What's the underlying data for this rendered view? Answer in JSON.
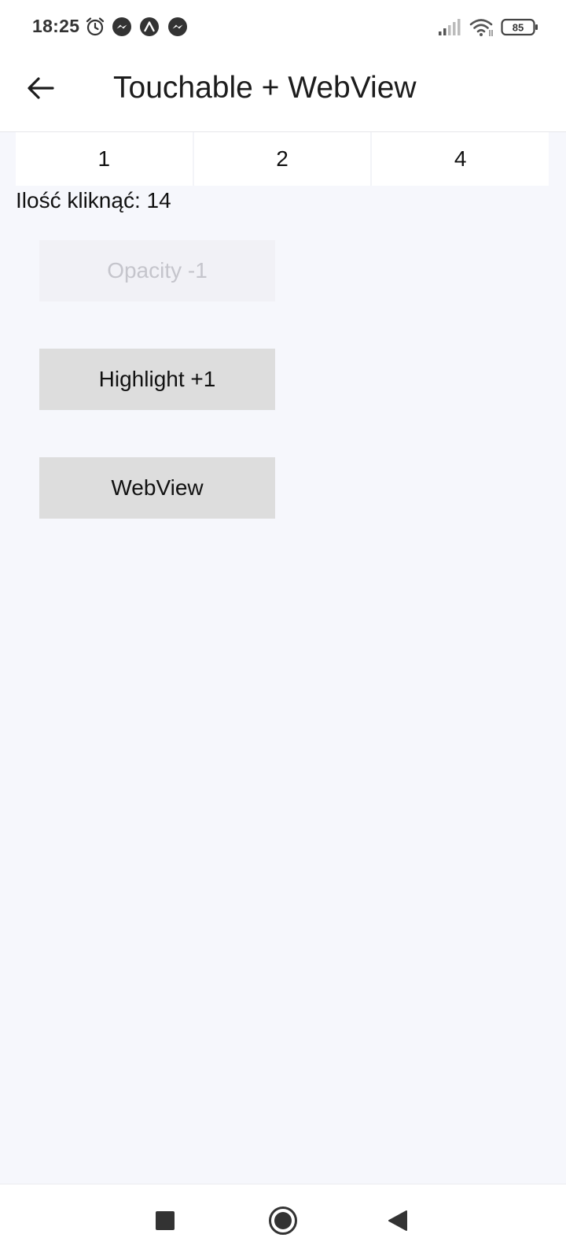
{
  "status_bar": {
    "time": "18:25",
    "battery": "85",
    "icons": [
      "alarm-icon",
      "messenger-icon",
      "expo-icon",
      "messenger-icon",
      "signal-icon",
      "wifi-icon",
      "battery-icon"
    ]
  },
  "app_bar": {
    "title": "Touchable + WebView",
    "back_icon": "arrow-left-icon"
  },
  "counters": {
    "values": [
      "1",
      "2",
      "4"
    ]
  },
  "click_count": {
    "text": "Ilość kliknąć: 14"
  },
  "buttons": {
    "opacity_label": "Opacity -1",
    "highlight_label": "Highlight +1",
    "webview_label": "WebView"
  },
  "nav_bar": {
    "icons": [
      "recents-square-icon",
      "home-circle-icon",
      "back-triangle-icon"
    ]
  },
  "colors": {
    "background": "#f6f7fc",
    "surface": "#ffffff",
    "button_gray": "#dddddd",
    "disabled_button": "#f1f1f6",
    "disabled_text": "#c5c5cc",
    "text": "#111111"
  }
}
